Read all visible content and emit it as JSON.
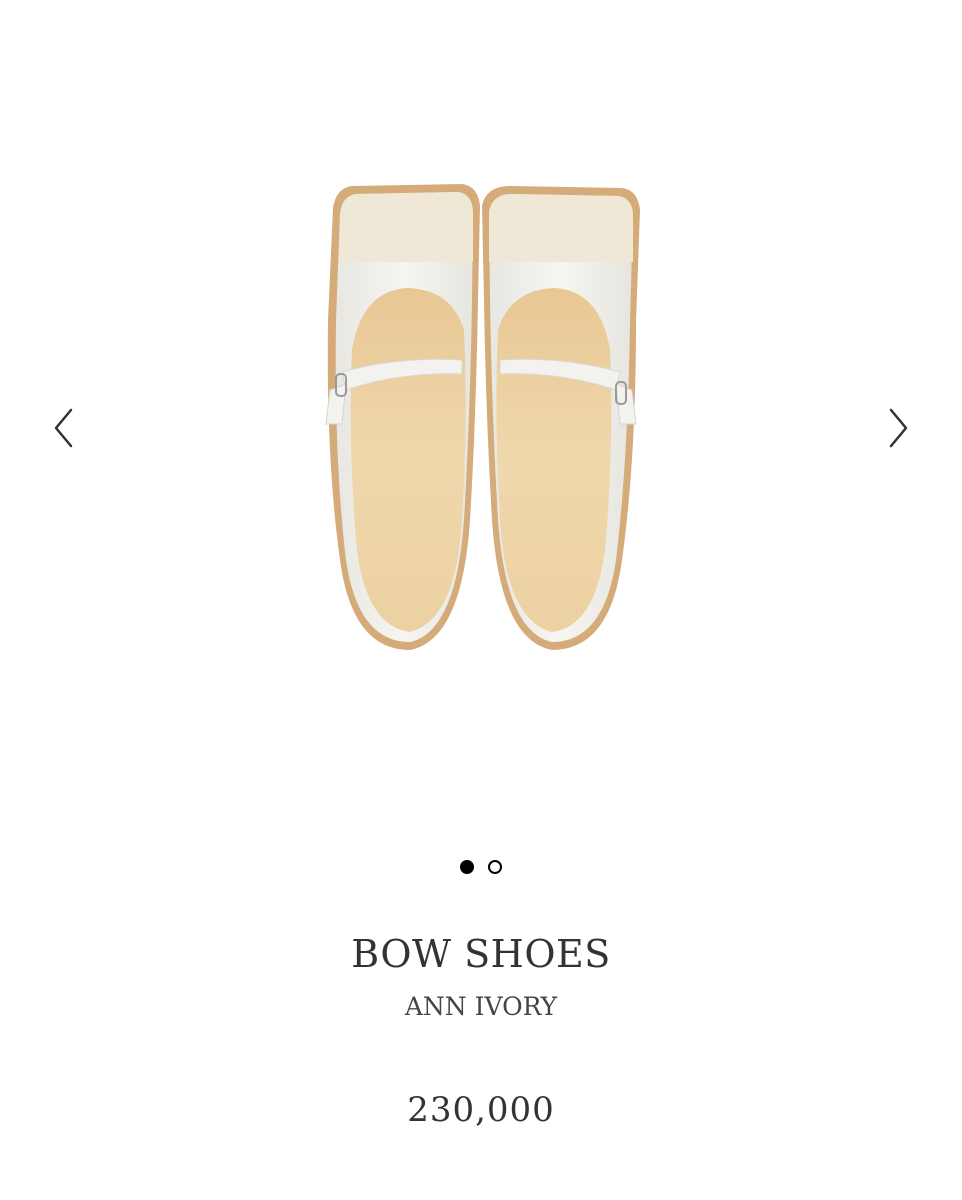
{
  "gallery": {
    "image_alt": "BOW SHOES ANN IVORY",
    "prev_icon": "chevron-left-icon",
    "next_icon": "chevron-right-icon",
    "slide_count": 2,
    "active_slide": 1
  },
  "product": {
    "title": "BOW SHOES",
    "variant": "ANN IVORY",
    "price": "230,000"
  },
  "colors": {
    "shoe_ivory": "#f2f1ec",
    "toe_cap": "#efe9d9",
    "insole": "#ecd3a6",
    "sole_edge": "#d4a979",
    "text": "#333333",
    "dot": "#000000"
  }
}
